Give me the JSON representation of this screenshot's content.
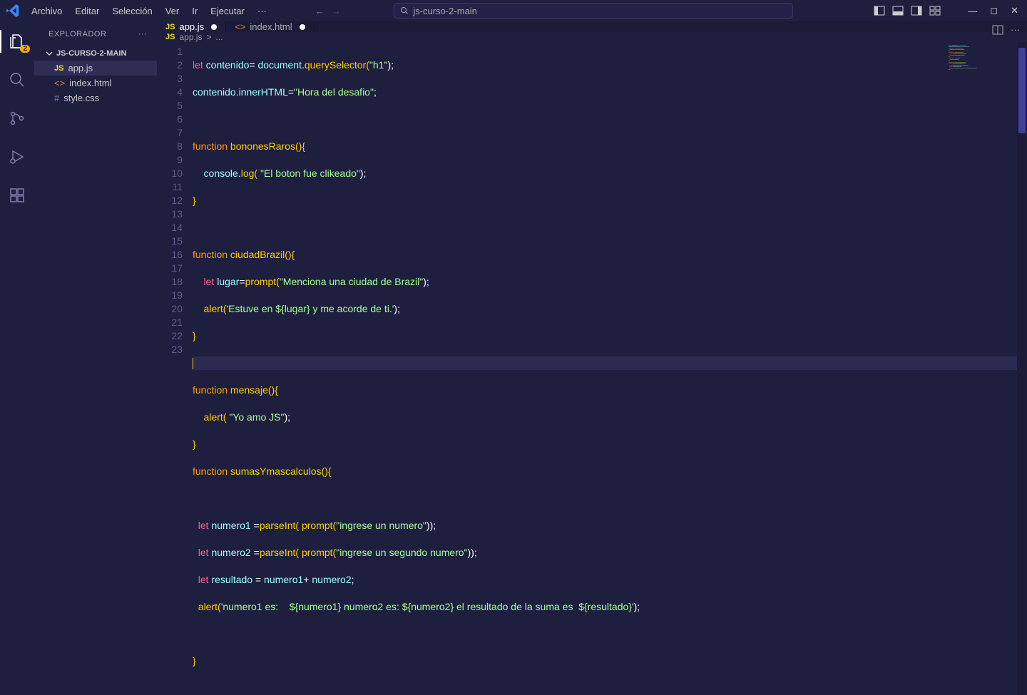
{
  "menu": {
    "archivo": "Archivo",
    "editar": "Editar",
    "seleccion": "Selección",
    "ver": "Ver",
    "ir": "Ir",
    "ejecutar": "Ejecutar",
    "more": "···"
  },
  "search": {
    "text": "js-curso-2-main"
  },
  "activity": {
    "badge": "2"
  },
  "sidebar": {
    "title": "EXPLORADOR",
    "project": "JS-CURSO-2-MAIN",
    "files": {
      "appjs": "app.js",
      "index": "index.html",
      "style": "style.css"
    }
  },
  "tabs": {
    "appjs": "app.js",
    "index": "index.html"
  },
  "breadcrumb": {
    "icon": "JS",
    "file": "app.js",
    "sep": ">",
    "more": "..."
  },
  "gutter": [
    "1",
    "2",
    "3",
    "4",
    "5",
    "6",
    "7",
    "8",
    "9",
    "10",
    "11",
    "12",
    "13",
    "14",
    "15",
    "16",
    "17",
    "18",
    "19",
    "20",
    "21",
    "22",
    "23"
  ],
  "code": {
    "l1a": "let",
    "l1b": " contenido",
    "l1c": "= ",
    "l1d": "document",
    "l1e": ".",
    "l1f": "querySelector",
    "l1g": "(",
    "l1h": "\"h1\"",
    "l1i": ");",
    "l2a": "contenido",
    "l2b": ".",
    "l2c": "innerHTML",
    "l2d": "=",
    "l2e": "\"Hora del desafio\"",
    "l2f": ";",
    "l4a": "function",
    "l4b": " bononesRaros",
    "l4c": "(){",
    "l5a": "    console",
    "l5b": ".",
    "l5c": "log",
    "l5d": "( ",
    "l5e": "\"El boton fue clikeado\"",
    "l5f": ");",
    "l6a": "}",
    "l8a": "function",
    "l8b": " ciudadBrazil",
    "l8c": "(){",
    "l9a": "    let",
    "l9b": " lugar",
    "l9c": "=",
    "l9d": "prompt",
    "l9e": "(",
    "l9f": "\"Menciona una ciudad de Brazil\"",
    "l9g": ");",
    "l10a": "    alert",
    "l10b": "(",
    "l10c": "'Estuve en ${lugar} y me acorde de ti.'",
    "l10d": ");",
    "l11a": "}",
    "l13a": "function",
    "l13b": " mensaje",
    "l13c": "(){",
    "l14a": "    alert",
    "l14b": "( ",
    "l14c": "\"Yo amo JS\"",
    "l14d": ");",
    "l15a": "}",
    "l16a": "function",
    "l16b": " sumasYmascalculos",
    "l16c": "(){",
    "l18a": "  let",
    "l18b": " numero1 ",
    "l18c": "=",
    "l18d": "parseInt",
    "l18e": "( ",
    "l18f": "prompt",
    "l18g": "(",
    "l18h": "\"ingrese un numero\"",
    "l18i": "));",
    "l19a": "  let",
    "l19b": " numero2 ",
    "l19c": "=",
    "l19d": "parseInt",
    "l19e": "( ",
    "l19f": "prompt",
    "l19g": "(",
    "l19h": "\"ingrese un segundo numero\"",
    "l19i": "));",
    "l20a": "  let",
    "l20b": " resultado ",
    "l20c": "= ",
    "l20d": "numero1",
    "l20e": "+ ",
    "l20f": "numero2",
    "l20g": ";",
    "l21a": "  alert",
    "l21b": "(",
    "l21c": "'numero1 es:    ${numero1} numero2 es: ${numero2} el resultado de la suma es  ${resultado}'",
    "l21d": ");",
    "l23a": "}"
  }
}
